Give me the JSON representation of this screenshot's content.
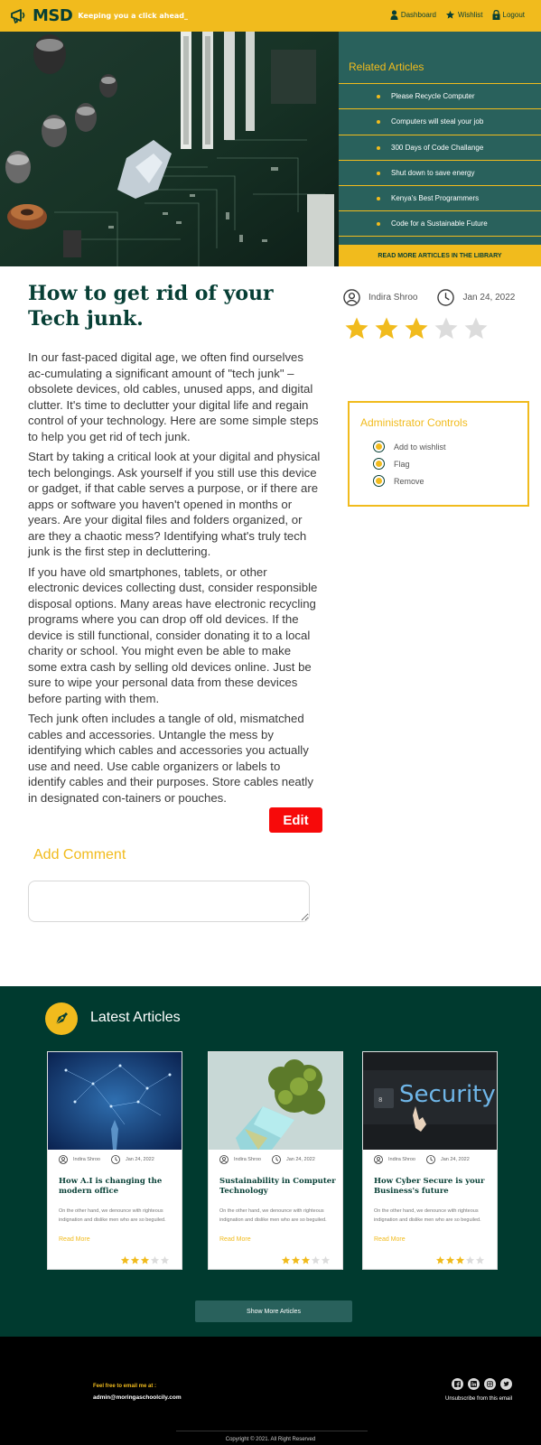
{
  "header": {
    "brand": "MSD",
    "tagline": "Keeping you a click ahead_",
    "nav": [
      {
        "label": "Dashboard",
        "icon": "user-icon"
      },
      {
        "label": "Wishlist",
        "icon": "star-icon"
      },
      {
        "label": "Logout",
        "icon": "lock-icon"
      }
    ]
  },
  "related": {
    "title": "Related Articles",
    "items": [
      "Please Recycle Computer",
      "Computers will steal your job",
      "300 Days of Code Challange",
      "Shut down to save energy",
      "Kenya's Best Programmers",
      "Code for a Sustainable Future"
    ],
    "more_label": "READ MORE ARTICLES IN THE LIBRARY"
  },
  "article": {
    "title": "How to get rid of your Tech junk.",
    "author": "Indira Shroo",
    "date": "Jan 24, 2022",
    "rating": 3,
    "rating_max": 5,
    "paragraphs": [
      "In our fast-paced digital age, we often find ourselves ac-cumulating a significant amount of \"tech junk\" – obsolete devices, old cables, unused apps, and digital clutter. It's time to declutter your digital life and regain control of your technology. Here are some simple steps to help you get rid of tech junk.",
      "Start by taking a critical look at your digital and physical tech belongings. Ask yourself if you still use this device or gadget, if that cable serves a purpose, or if there are apps or software you haven't opened in months or years. Are your digital files and folders organized, or are they a chaotic mess? Identifying what's truly tech junk is the first step in decluttering.",
      "If you have old smartphones, tablets, or other electronic devices collecting dust, consider responsible disposal options. Many areas have electronic recycling programs where you can drop off old devices. If the device is still functional, consider donating it to a local charity or school. You might even be able to make some extra cash by selling old devices online. Just be sure to wipe your personal data from these devices before parting with them.",
      "Tech junk often includes a tangle of old, mismatched cables and accessories. Untangle the mess by identifying which cables and accessories you actually use and need. Use cable organizers or labels to identify cables and their purposes. Store cables neatly in designated con-tainers or pouches."
    ],
    "edit_label": "Edit",
    "add_comment_label": "Add Comment",
    "comment_value": ""
  },
  "admin": {
    "title": "Administrator Controls",
    "items": [
      "Add to wishlist",
      "Flag",
      "Remove"
    ]
  },
  "latest": {
    "title": "Latest Articles",
    "cards": [
      {
        "author": "Indira Shroo",
        "date": "Jan 24, 2022",
        "title": "How A.I is changing the modern office",
        "text": "On the other hand, we denounce with righteous indignation and dislike men who are so beguiled.",
        "read_more": "Read More",
        "rating": 3
      },
      {
        "author": "Indira Shroo",
        "date": "Jan 24, 2022",
        "title": "Sustainability in Computer Technology",
        "text": "On the other hand, we denounce with righteous indignation and dislike men who are so beguiled.",
        "read_more": "Read More",
        "rating": 3
      },
      {
        "author": "Indira Shroo",
        "date": "Jan 24, 2022",
        "title": "How Cyber Secure is your Business's future",
        "text": "On the other hand, we denounce with righteous indignation and dislike men who are so beguiled.",
        "read_more": "Read More",
        "rating": 3
      }
    ],
    "card3_img_text": "Security",
    "show_more_label": "Show More Articles"
  },
  "footer": {
    "email_label": "Feel free to email me at :",
    "email": "admin@moringaschoolcily.com",
    "socials": [
      "facebook-icon",
      "linkedin-icon",
      "instagram-icon",
      "twitter-icon"
    ],
    "unsubscribe": "Unsubscribe from this email",
    "copyright": "Copyright © 2021. All Right Reserved"
  },
  "colors": {
    "brand_yellow": "#f1bb1d",
    "dark_green": "#073f35",
    "teal": "#29615c",
    "edit_red": "#f70a0a"
  }
}
